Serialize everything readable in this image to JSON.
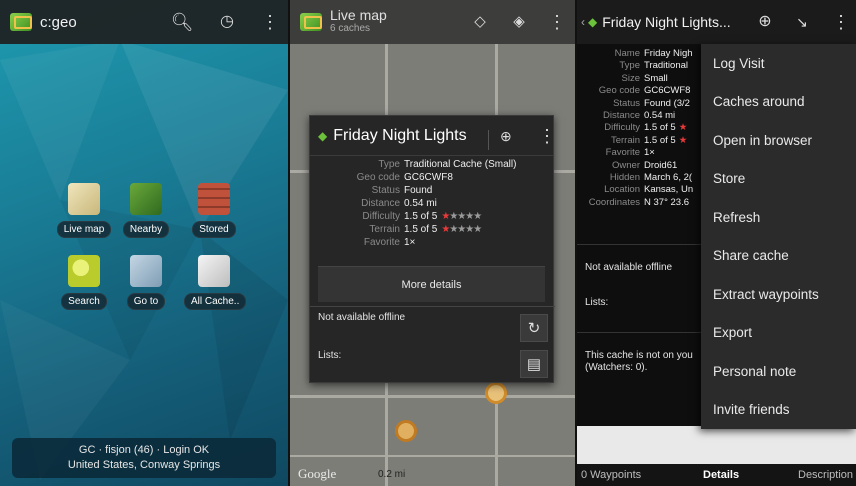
{
  "panel1": {
    "title": "c:geo",
    "icons": [
      "search-icon",
      "history-icon",
      "overflow-menu-icon"
    ],
    "tiles": [
      {
        "label": "Live map",
        "icon": "live-map-icon",
        "color": "#e6d9a8"
      },
      {
        "label": "Nearby",
        "icon": "nearby-icon",
        "color": "#4f8f2d"
      },
      {
        "label": "Stored",
        "icon": "stored-icon",
        "color": "#c0523b"
      },
      {
        "label": "Search",
        "icon": "search-tile-icon",
        "color": "#c7d83a"
      },
      {
        "label": "Go to",
        "icon": "go-to-icon",
        "color": "#9bb6c9"
      },
      {
        "label": "All Cache..",
        "icon": "all-caches-icon",
        "color": "#e8e8e8"
      }
    ],
    "status_line1": "GC · fisjon (46) · Login OK",
    "status_line2": "United States, Conway Springs"
  },
  "panel2": {
    "title": "Live map",
    "subtitle": "6 caches",
    "icons": [
      "target-icon",
      "layers-icon",
      "overflow-menu-icon"
    ],
    "card": {
      "title": "Friday Night Lights",
      "rows": [
        {
          "key": "Type",
          "value": "Traditional Cache (Small)"
        },
        {
          "key": "Geo code",
          "value": "GC6CWF8"
        },
        {
          "key": "Status",
          "value": "Found"
        },
        {
          "key": "Distance",
          "value": "0.54 mi"
        },
        {
          "key": "Difficulty",
          "value": "1.5 of 5"
        },
        {
          "key": "Terrain",
          "value": "1.5 of 5"
        },
        {
          "key": "Favorite",
          "value": "1×"
        }
      ],
      "difficulty_rating": 1.5,
      "terrain_rating": 1.5,
      "more_details": "More details",
      "offline": "Not available offline",
      "lists": "Lists:"
    },
    "map_label_google": "Google",
    "map_scale": "0.2 mi"
  },
  "panel3": {
    "title": "Friday Night Lights...",
    "rows": [
      {
        "key": "Name",
        "value": "Friday Nigh"
      },
      {
        "key": "Type",
        "value": "Traditional"
      },
      {
        "key": "Size",
        "value": "Small"
      },
      {
        "key": "Geo code",
        "value": "GC6CWF8"
      },
      {
        "key": "Status",
        "value": "Found (3/2"
      },
      {
        "key": "Distance",
        "value": "0.54 mi"
      },
      {
        "key": "Difficulty",
        "value": "1.5 of 5"
      },
      {
        "key": "Terrain",
        "value": "1.5 of 5"
      },
      {
        "key": "Favorite",
        "value": "1×"
      },
      {
        "key": "Owner",
        "value": "Droid61"
      },
      {
        "key": "Hidden",
        "value": "March 6, 2("
      },
      {
        "key": "Location",
        "value": "Kansas, Un"
      },
      {
        "key": "Coordinates",
        "value": "N 37° 23.6"
      }
    ],
    "offline": "Not available offline",
    "lists": "Lists:",
    "watch_line1": "This cache is not on you",
    "watch_line2": "(Watchers: 0).",
    "menu": [
      "Log Visit",
      "Caches around",
      "Open in browser",
      "Store",
      "Refresh",
      "Share cache",
      "Extract waypoints",
      "Export",
      "Personal note",
      "Invite friends"
    ],
    "tabs": [
      "0 Waypoints",
      "Details",
      "Description"
    ]
  },
  "colors": {
    "dashboard_bg": "#1a7f98",
    "accent_green": "#6cc23a",
    "star_red": "#e83a3a",
    "menu_bg": "#2b2b2b"
  }
}
